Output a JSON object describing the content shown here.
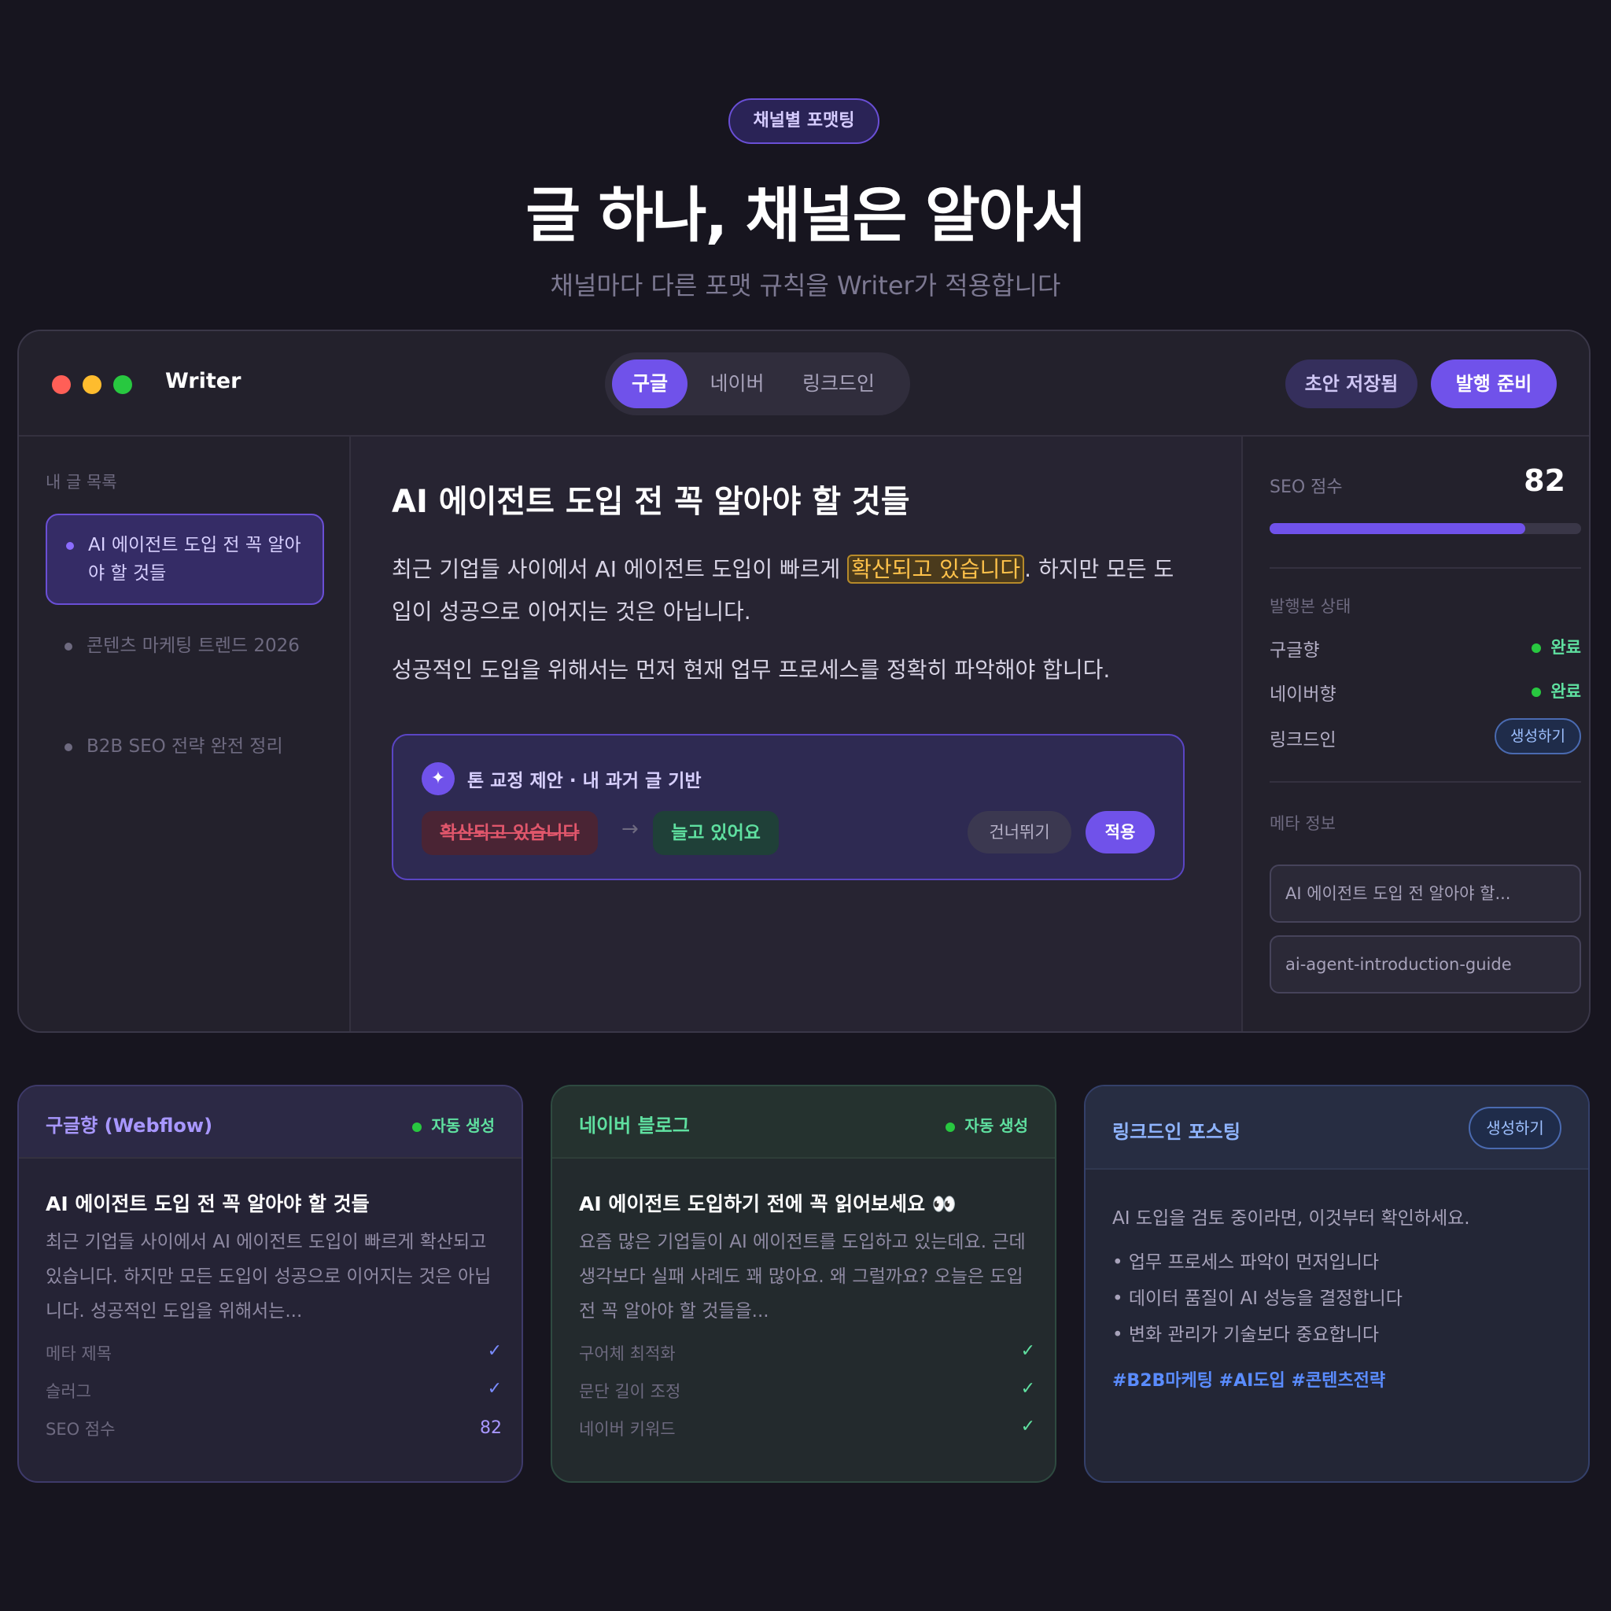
{
  "hero": {
    "badge": "채널별 포맷팅",
    "title": "글 하나, 채널은 알아서",
    "subtitle": "채널마다 다른 포맷 규칙을 Writer가 적용합니다"
  },
  "window": {
    "app_name": "Writer",
    "tabs": [
      {
        "label": "구글",
        "active": true
      },
      {
        "label": "네이버",
        "active": false
      },
      {
        "label": "링크드인",
        "active": false
      }
    ],
    "draft_status": "초안 저장됨",
    "publish_button": "발행 준비"
  },
  "sidebar": {
    "title": "내 글 목록",
    "items": [
      {
        "label": "AI 에이전트 도입 전 꼭 알아야 할 것들",
        "active": true
      },
      {
        "label": "콘텐츠 마케팅 트렌드 2026",
        "active": false
      },
      {
        "label": "B2B SEO 전략 완전 정리",
        "active": false
      }
    ]
  },
  "editor": {
    "title": "AI 에이전트 도입 전 꼭 알아야 할 것들",
    "para1_before": "최근 기업들 사이에서 AI 에이전트 도입이 빠르게 ",
    "para1_highlight": "확산되고 있습니다",
    "para1_after": ". 하지만 모든 도입이 성공으로 이어지는 것은 아닙니다.",
    "para2": "성공적인 도입을 위해서는 먼저 현재 업무 프로세스를 정확히 파악해야 합니다.",
    "suggestion": {
      "icon": "sparkle-icon",
      "title": "톤 교정 제안 · 내 과거 글 기반",
      "old_text": "확산되고 있습니다",
      "arrow": "→",
      "new_text": "늘고 있어요",
      "skip_label": "건너뛰기",
      "apply_label": "적용"
    }
  },
  "right_panel": {
    "seo_label": "SEO 점수",
    "seo_score": "82",
    "seo_fraction": 0.82,
    "publish_status_title": "발행본 상태",
    "status": [
      {
        "name": "구글향",
        "value": "완료"
      },
      {
        "name": "네이버향",
        "value": "완료"
      },
      {
        "name": "링크드인",
        "action": "생성하기"
      }
    ],
    "meta_title": "메타 정보",
    "meta_title_value": "AI 에이전트 도입 전 알아야 할...",
    "meta_slug_value": "ai-agent-introduction-guide"
  },
  "cards": {
    "google": {
      "name": "구글향 (Webflow)",
      "badge": "자동 생성",
      "title": "AI 에이전트 도입 전 꼭 알아야 할 것들",
      "body": "최근 기업들 사이에서 AI 에이전트 도입이 빠르게 확산되고 있습니다. 하지만 모든 도입이 성공으로 이어지는 것은 아닙니다. 성공적인 도입을 위해서는...",
      "checks": [
        {
          "name": "메타 제목",
          "mark": "✓"
        },
        {
          "name": "슬러그",
          "mark": "✓"
        },
        {
          "name": "SEO 점수",
          "value": "82"
        }
      ]
    },
    "naver": {
      "name": "네이버 블로그",
      "badge": "자동 생성",
      "title": "AI 에이전트 도입하기 전에 꼭 읽어보세요 👀",
      "body": "요즘 많은 기업들이 AI 에이전트를 도입하고 있는데요. 근데 생각보다 실패 사례도 꽤 많아요. 왜 그럴까요? 오늘은 도입 전 꼭 알아야 할 것들을...",
      "checks": [
        {
          "name": "구어체 최적화",
          "mark": "✓"
        },
        {
          "name": "문단 길이 조정",
          "mark": "✓"
        },
        {
          "name": "네이버 키워드",
          "mark": "✓"
        }
      ]
    },
    "linkedin": {
      "name": "링크드인 포스팅",
      "action": "생성하기",
      "intro": "AI 도입을 검토 중이라면, 이것부터 확인하세요.",
      "bullets": [
        "• 업무 프로세스 파악이 먼저입니다",
        "• 데이터 품질이 AI 성능을 결정합니다",
        "• 변화 관리가 기술보다 중요합니다"
      ],
      "tags": "#B2B마케팅 #AI도입 #콘텐츠전략"
    }
  },
  "colors": {
    "accent": "#7052ea",
    "success": "#28c840",
    "highlight": "#ffc24a",
    "link": "#5a8cff"
  }
}
